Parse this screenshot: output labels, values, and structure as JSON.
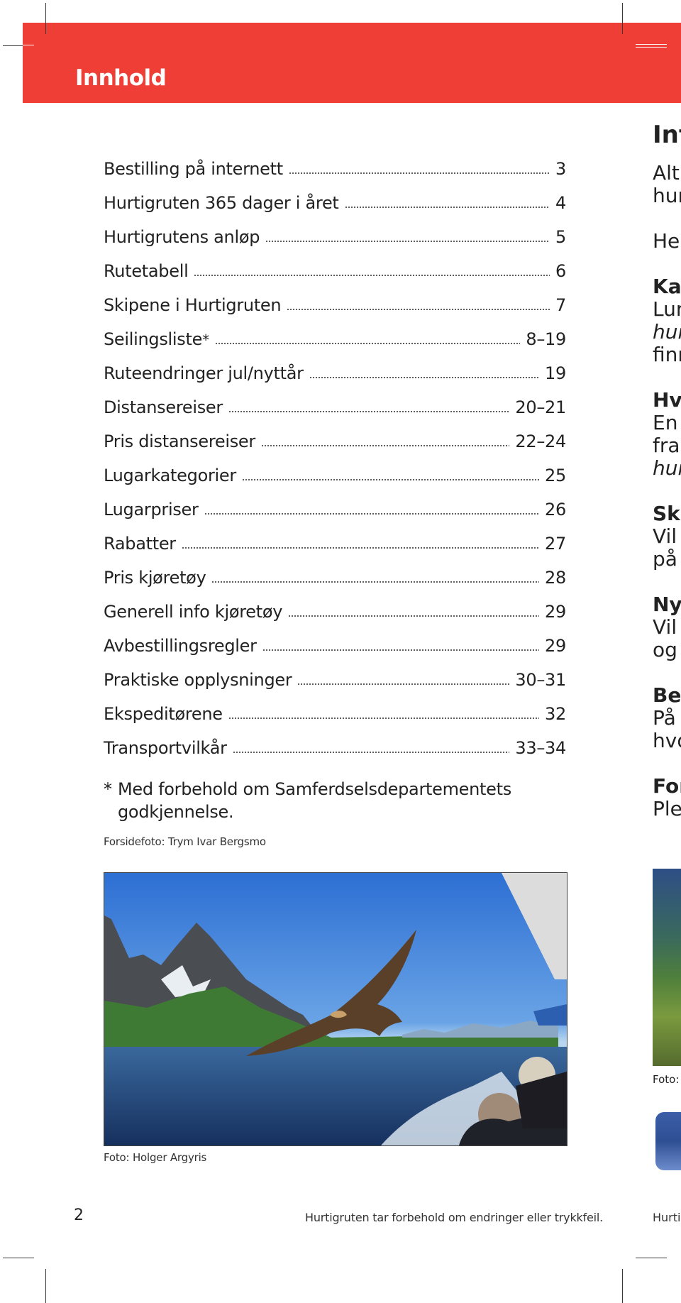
{
  "header": {
    "title": "Innhold",
    "accent_color": "#ee3e36"
  },
  "toc": {
    "items": [
      {
        "title": "Bestilling på internett",
        "page": "3"
      },
      {
        "title": "Hurtigruten 365 dager i året",
        "page": "4"
      },
      {
        "title": "Hurtigrutens anløp",
        "page": "5"
      },
      {
        "title": "Rutetabell",
        "page": "6"
      },
      {
        "title": "Skipene i Hurtigruten",
        "page": "7"
      },
      {
        "title": "Seilingsliste",
        "marker": "*",
        "page": "8–19"
      },
      {
        "title": "Ruteendringer jul/nyttår",
        "page": "19"
      },
      {
        "title": "Distansereiser",
        "page": "20–21"
      },
      {
        "title": "Pris distansereiser",
        "page": "22–24"
      },
      {
        "title": "Lugarkategorier",
        "page": "25"
      },
      {
        "title": "Lugarpriser",
        "page": "26"
      },
      {
        "title": "Rabatter",
        "page": "27"
      },
      {
        "title": "Pris kjøretøy",
        "page": "28"
      },
      {
        "title": "Generell info kjøretøy",
        "page": "29"
      },
      {
        "title": "Avbestillingsregler",
        "page": "29"
      },
      {
        "title": "Praktiske opplysninger",
        "page": "30–31"
      },
      {
        "title": "Ekspeditørene",
        "page": "32"
      },
      {
        "title": "Transportvilkår",
        "page": "33–34"
      }
    ],
    "footnote_star": "*",
    "footnote_line1": "Med forbehold om Samferdselsdepartementets",
    "footnote_line2": "godkjennelse.",
    "cover_credit": "Forsidefoto: Trym Ivar Bergsmo"
  },
  "photo": {
    "subject": "Sea eagle flying beside ship in fjord with photographers",
    "credit": "Foto: Holger Argyris"
  },
  "right_column": {
    "heading": "Inf",
    "lines": [
      {
        "text": "Alt",
        "style": "normal"
      },
      {
        "text": "hur",
        "style": "normal"
      },
      {
        "text": "Her",
        "style": "normal"
      },
      {
        "text": "Kar",
        "style": "bold"
      },
      {
        "text": "Lur",
        "style": "normal"
      },
      {
        "text": "hur",
        "style": "italic"
      },
      {
        "text": "finn",
        "style": "normal"
      },
      {
        "text": "Hvi",
        "style": "bold"
      },
      {
        "text": "En",
        "style": "normal"
      },
      {
        "text": "fra",
        "style": "normal"
      },
      {
        "text": "hur",
        "style": "italic"
      },
      {
        "text": "Ski",
        "style": "bold"
      },
      {
        "text": "Vil",
        "style": "normal"
      },
      {
        "text": "på",
        "style": "normal"
      },
      {
        "text": "Nyl",
        "style": "bold"
      },
      {
        "text": "Vil",
        "style": "normal"
      },
      {
        "text": "og",
        "style": "normal"
      },
      {
        "text": "Bes",
        "style": "bold"
      },
      {
        "text": "På",
        "style": "normal"
      },
      {
        "text": "hvo",
        "style": "normal"
      },
      {
        "text": "For",
        "style": "bold"
      },
      {
        "text": "Ple",
        "style": "normal"
      }
    ],
    "photo_credit": "Foto:",
    "footer_text": "Hurtig"
  },
  "footer": {
    "page_number": "2",
    "disclaimer": "Hurtigruten tar forbehold om endringer eller trykkfeil."
  }
}
